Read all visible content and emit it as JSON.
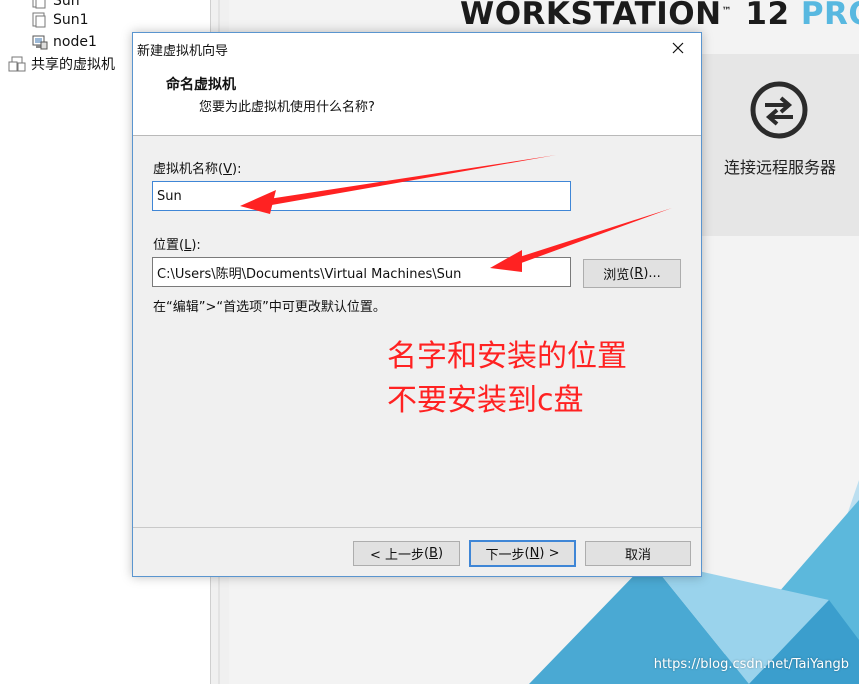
{
  "library": {
    "items": [
      {
        "label": "Sun"
      },
      {
        "label": "Sun1"
      },
      {
        "label": "node1"
      },
      {
        "label": "共享的虚拟机"
      }
    ]
  },
  "home": {
    "brand": "WORKSTATION",
    "brand_version": "12",
    "brand_edition": "PRO",
    "tile_remote_label": "连接远程服务器",
    "watermark": "https://blog.csdn.net/TaiYangb"
  },
  "dialog": {
    "title": "新建虚拟机向导",
    "header_title": "命名虚拟机",
    "header_subtitle": "您要为此虚拟机使用什么名称?",
    "name_label": "虚拟机名称",
    "name_hotkey": "V",
    "name_value": "Sun",
    "location_label": "位置",
    "location_hotkey": "L",
    "location_value": "C:\\Users\\陈明\\Documents\\Virtual Machines\\Sun",
    "browse_label": "浏览",
    "browse_hotkey": "R",
    "hint": "在“编辑”>“首选项”中可更改默认位置。",
    "back_label": "< 上一步",
    "back_hotkey": "B",
    "next_label": "下一步",
    "next_hotkey": "N",
    "cancel_label": "取消"
  },
  "annotation": {
    "line1": "名字和安装的位置",
    "line2": "不要安装到c盘",
    "color": "#ff2222"
  },
  "colors": {
    "accent": "#3f86d6",
    "dialog_border": "#5a95cf",
    "brand_pro": "#58b8e0"
  }
}
